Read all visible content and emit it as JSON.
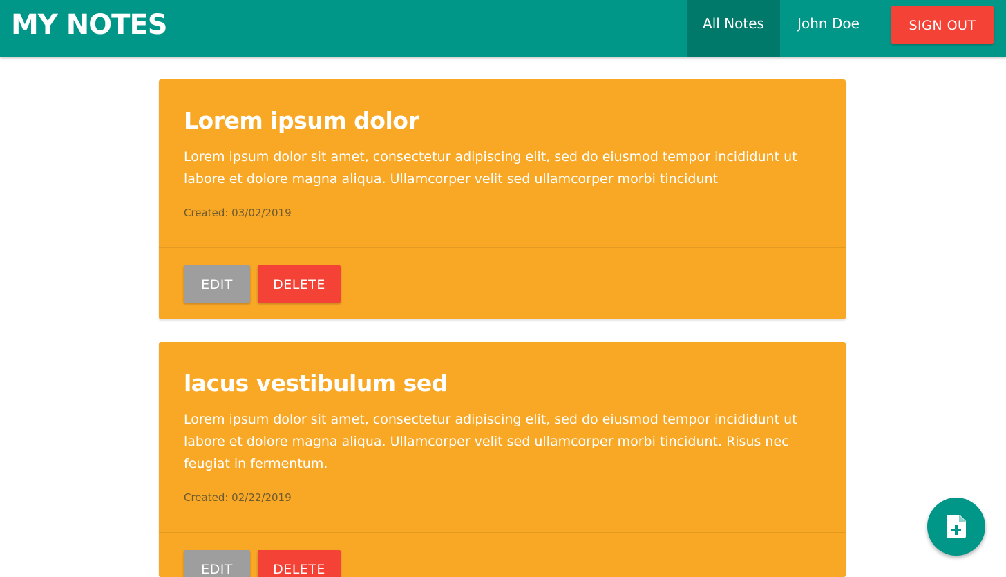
{
  "app": {
    "title": "MY NOTES"
  },
  "nav": {
    "all_notes": "All Notes",
    "user": "John Doe",
    "sign_out": "SIGN OUT"
  },
  "notes": [
    {
      "title": "Lorem ipsum dolor",
      "body": "Lorem ipsum dolor sit amet, consectetur adipiscing elit, sed do eiusmod tempor incididunt ut labore et dolore magna aliqua. Ullamcorper velit sed ullamcorper morbi tincidunt",
      "created": "Created: 03/02/2019",
      "edit_label": "EDIT",
      "delete_label": "DELETE"
    },
    {
      "title": "lacus vestibulum sed",
      "body": "Lorem ipsum dolor sit amet, consectetur adipiscing elit, sed do eiusmod tempor incididunt ut labore et dolore magna aliqua. Ullamcorper velit sed ullamcorper morbi tincidunt. Risus nec feugiat in fermentum.",
      "created": "Created: 02/22/2019",
      "edit_label": "EDIT",
      "delete_label": "DELETE"
    }
  ],
  "fab": {
    "icon": "add-note-icon"
  },
  "colors": {
    "primary": "#009688",
    "primary_dark": "#00796b",
    "danger": "#f44336",
    "note_background": "#f9a826",
    "edit_button": "#9e9e9e"
  }
}
